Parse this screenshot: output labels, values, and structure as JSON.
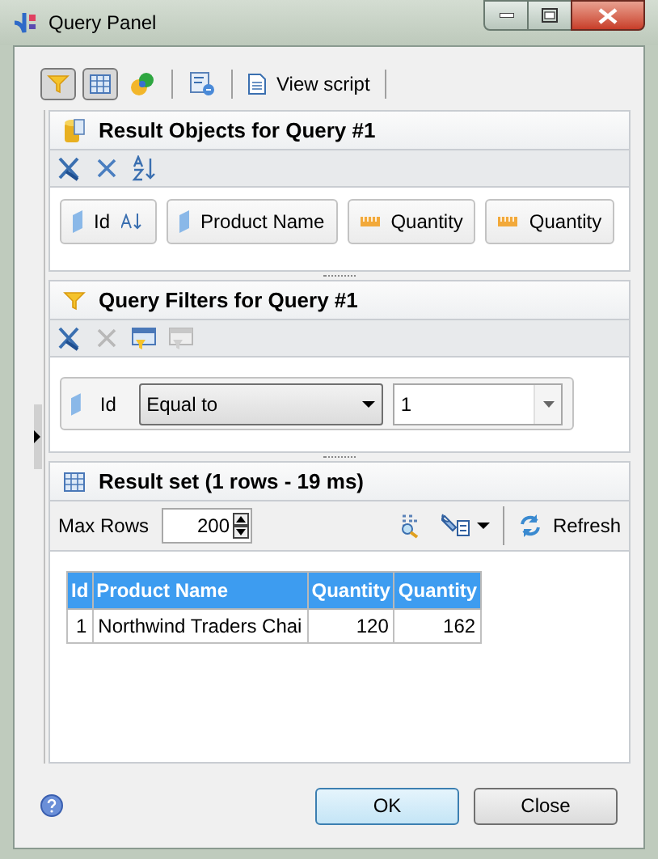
{
  "window": {
    "title": "Query Panel"
  },
  "toolbar": [
    {
      "kind": "toggle",
      "selected": true
    },
    {
      "kind": "toggle",
      "selected": true
    },
    {
      "kind": "toggle",
      "selected": false
    },
    {
      "kind": "separator"
    },
    {
      "kind": "toggle",
      "selected": false
    },
    {
      "kind": "separator"
    },
    {
      "kind": "button",
      "label": "View script"
    },
    {
      "kind": "separator"
    }
  ],
  "result_objects": {
    "title": "Result Objects for Query #1",
    "items": [
      {
        "kind": "dimension",
        "label": "Id",
        "sorted": true
      },
      {
        "kind": "dimension",
        "label": "Product Name",
        "sorted": false
      },
      {
        "kind": "measure",
        "label": "Quantity",
        "sorted": false
      },
      {
        "kind": "measure",
        "label": "Quantity",
        "sorted": false
      }
    ]
  },
  "query_filters": {
    "title": "Query Filters for Query #1",
    "actions": [
      {
        "disabled": false
      },
      {
        "disabled": true
      },
      {
        "disabled": false
      },
      {
        "disabled": true
      }
    ],
    "filters": [
      {
        "kind": "dimension",
        "field": "Id",
        "operator": "Equal to",
        "value": "1"
      }
    ]
  },
  "result_set": {
    "title": "Result set (1 rows - 19 ms)",
    "max_rows_label": "Max Rows",
    "max_rows": "200",
    "refresh": "Refresh",
    "columns": [
      {
        "label": "Id",
        "kind": "number"
      },
      {
        "label": "Product Name",
        "kind": "text"
      },
      {
        "label": "Quantity",
        "kind": "number"
      },
      {
        "label": "Quantity",
        "kind": "number"
      }
    ],
    "rows": [
      [
        "1",
        "Northwind Traders Chai",
        "120",
        "162"
      ]
    ]
  },
  "buttons": [
    {
      "label": "OK",
      "default": true
    },
    {
      "label": "Close",
      "default": false
    }
  ]
}
